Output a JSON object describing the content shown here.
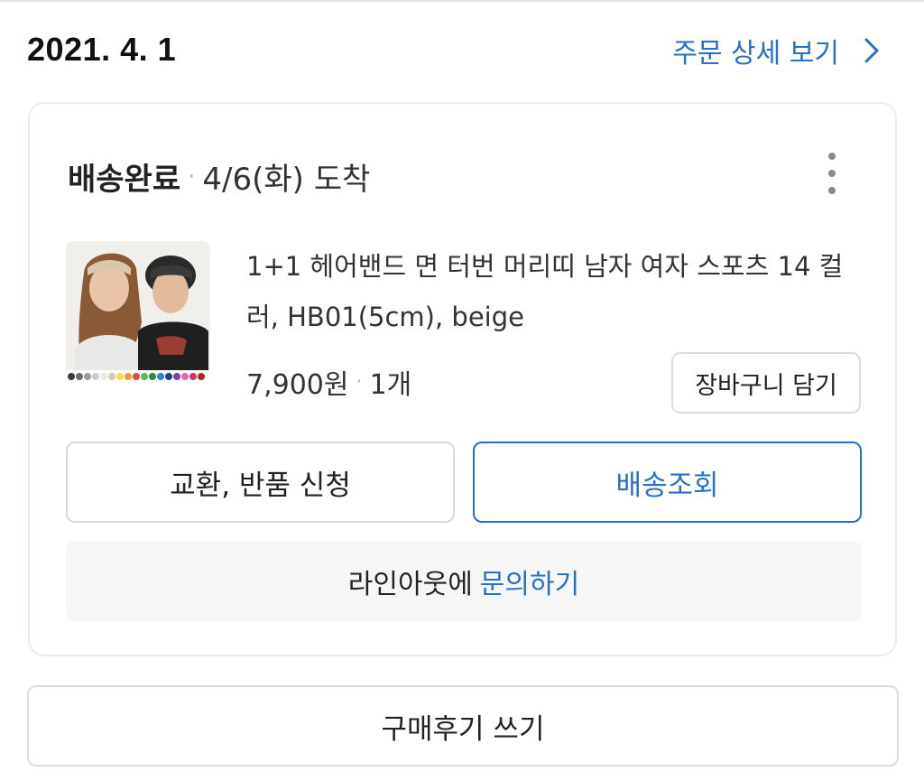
{
  "order": {
    "date": "2021. 4. 1",
    "detail_link_label": "주문 상세 보기"
  },
  "shipment": {
    "status": "배송완료",
    "separator": "·",
    "arrival": "4/6(화) 도착"
  },
  "product": {
    "name": "1+1 헤어밴드 면 터번 머리띠 남자 여자 스포츠 14 컬러, HB01(5cm), beige",
    "price": "7,900원",
    "separator": "·",
    "quantity": "1개",
    "swatch_colors": [
      "#3a3a3a",
      "#6b6b6b",
      "#9a9a9a",
      "#c9c9c9",
      "#e8e8e8",
      "#d8c7a8",
      "#f1e04a",
      "#f39a2d",
      "#e84a3a",
      "#5cb85c",
      "#2c8a3f",
      "#2f7fd1",
      "#1e3f8c",
      "#7a3fb5",
      "#e46aa8",
      "#d9306a",
      "#c02020"
    ]
  },
  "buttons": {
    "add_to_cart": "장바구니 담기",
    "exchange_return": "교환, 반품 신청",
    "tracking": "배송조회",
    "write_review": "구매후기 쓰기"
  },
  "inquiry": {
    "prefix": "라인아웃에",
    "link": "문의하기"
  },
  "colors": {
    "accent": "#2a6fc6"
  }
}
